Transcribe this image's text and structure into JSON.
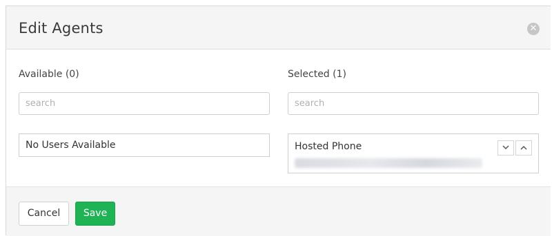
{
  "dialog": {
    "title": "Edit Agents",
    "close_icon": "close-circle-icon"
  },
  "available": {
    "heading": "Available (0)",
    "search_placeholder": "search",
    "empty_message": "No Users Available"
  },
  "selected": {
    "heading": "Selected (1)",
    "search_placeholder": "search",
    "items": [
      {
        "name": "Hosted Phone"
      }
    ],
    "move_down_icon": "chevron-down-icon",
    "move_up_icon": "chevron-up-icon"
  },
  "footer": {
    "cancel_label": "Cancel",
    "save_label": "Save"
  },
  "colors": {
    "save_button": "#1fb356",
    "header_background": "#f5f5f5"
  }
}
